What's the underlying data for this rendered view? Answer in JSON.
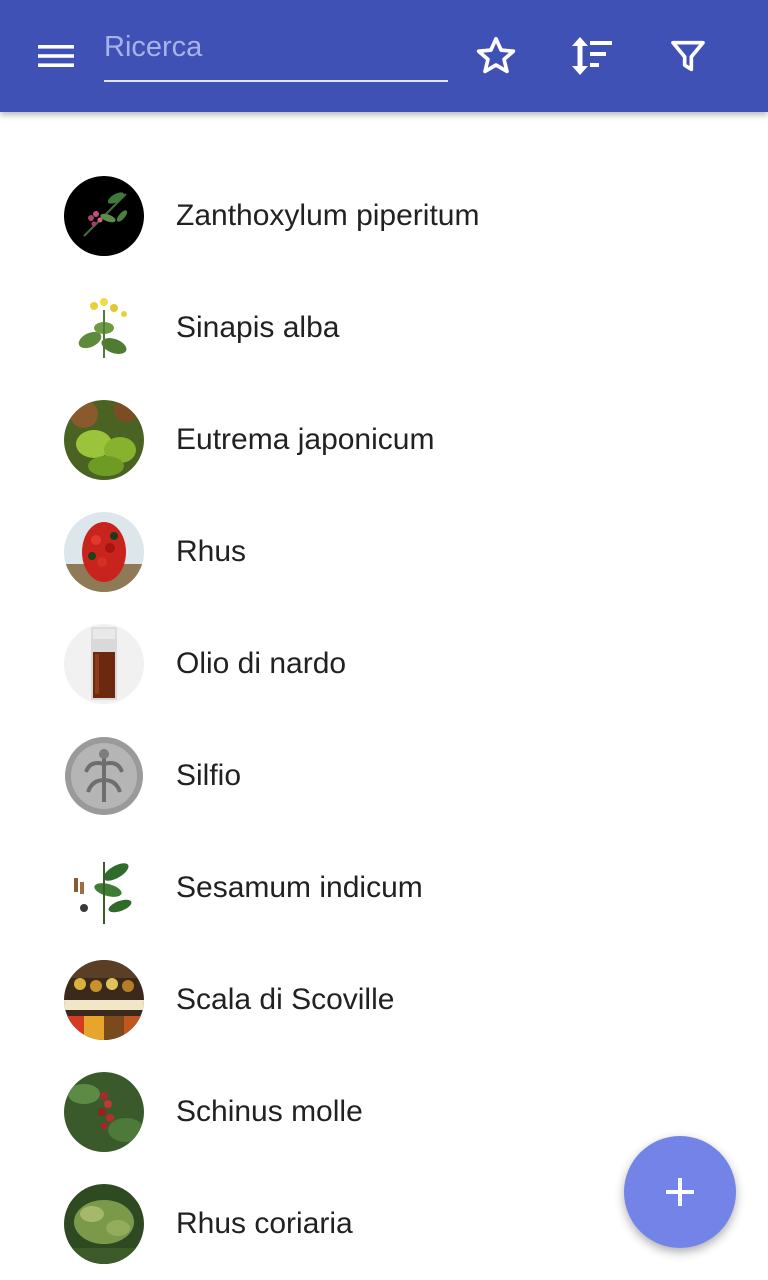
{
  "toolbar": {
    "background": "#3f51b5",
    "menu_icon": "hamburger-menu-icon",
    "search": {
      "placeholder": "Ricerca",
      "value": ""
    },
    "actions": [
      {
        "icon": "star-outline-icon"
      },
      {
        "icon": "sort-icon"
      },
      {
        "icon": "filter-icon"
      }
    ]
  },
  "list": {
    "items": [
      {
        "label": "Zanthoxylum piperitum",
        "thumb_icon": "pepper-branch-on-black-thumbnail"
      },
      {
        "label": "Sinapis alba",
        "thumb_icon": "mustard-plant-illustration-thumbnail"
      },
      {
        "label": "Eutrema japonicum",
        "thumb_icon": "wasabi-leaves-thumbnail"
      },
      {
        "label": "Rhus",
        "thumb_icon": "red-sumac-berries-thumbnail"
      },
      {
        "label": "Olio di nardo",
        "thumb_icon": "oil-vial-thumbnail"
      },
      {
        "label": "Silfio",
        "thumb_icon": "ancient-coin-thumbnail"
      },
      {
        "label": "Sesamum indicum",
        "thumb_icon": "sesame-plant-illustration-thumbnail"
      },
      {
        "label": "Scala di Scoville",
        "thumb_icon": "spice-market-thumbnail"
      },
      {
        "label": "Schinus molle",
        "thumb_icon": "pink-peppercorn-tree-thumbnail"
      },
      {
        "label": "Rhus coriaria",
        "thumb_icon": "sumac-shrub-thumbnail"
      }
    ]
  },
  "fab": {
    "icon": "plus-icon",
    "color": "#7383e8"
  }
}
